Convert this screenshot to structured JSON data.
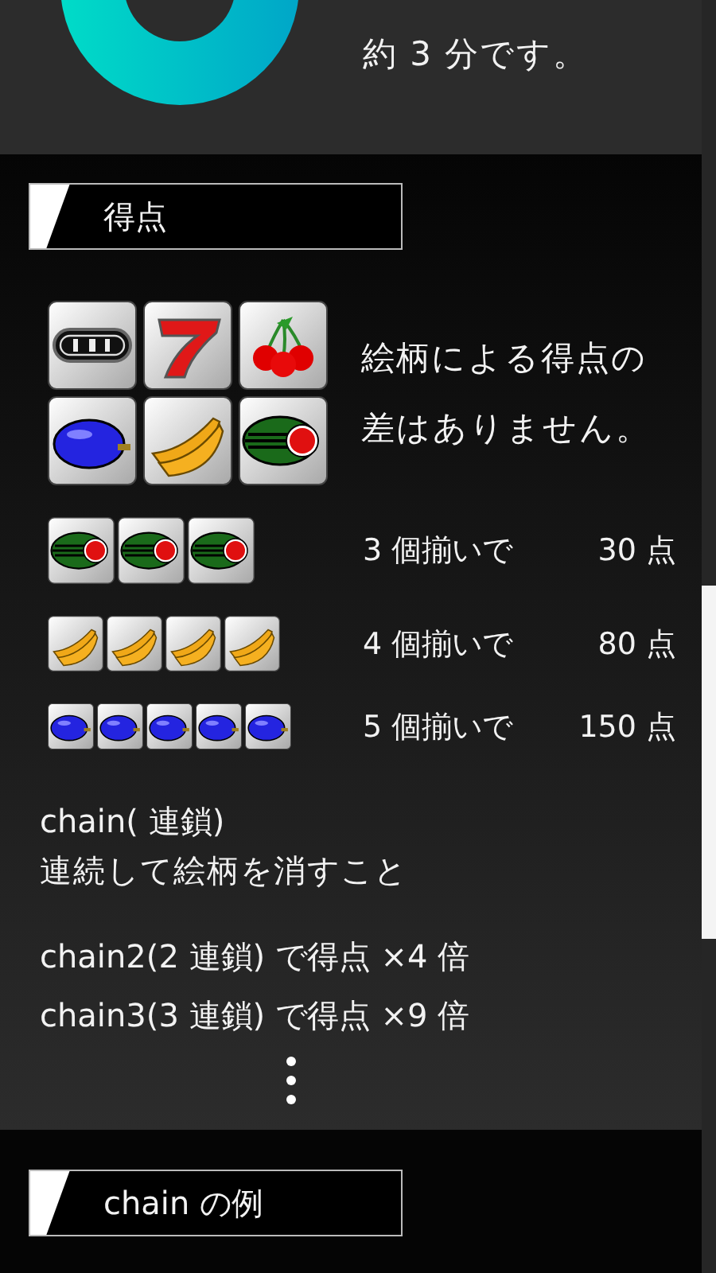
{
  "intro": {
    "text": "約 3 分です。"
  },
  "score_section": {
    "heading": "得点",
    "symbols": [
      {
        "kind": "bar"
      },
      {
        "kind": "seven"
      },
      {
        "kind": "cherry"
      },
      {
        "kind": "plum"
      },
      {
        "kind": "banana"
      },
      {
        "kind": "watermelon"
      }
    ],
    "note": "絵柄による得点の差はありません。",
    "combos": [
      {
        "tiles": [
          {
            "kind": "watermelon"
          },
          {
            "kind": "watermelon"
          },
          {
            "kind": "watermelon"
          }
        ],
        "label": "3 個揃いで",
        "points": "30 点"
      },
      {
        "tiles": [
          {
            "kind": "banana"
          },
          {
            "kind": "banana"
          },
          {
            "kind": "banana"
          },
          {
            "kind": "banana"
          }
        ],
        "label": "4 個揃いで",
        "points": "80 点"
      },
      {
        "tiles": [
          {
            "kind": "plum"
          },
          {
            "kind": "plum"
          },
          {
            "kind": "plum"
          },
          {
            "kind": "plum"
          },
          {
            "kind": "plum"
          }
        ],
        "label": "5 個揃いで",
        "points": "150 点"
      }
    ]
  },
  "chain_section": {
    "term": "chain( 連鎖)",
    "definition": "連続して絵柄を消すこと",
    "examples": [
      "chain2(2 連鎖) で得点 ×4 倍",
      "chain3(3 連鎖) で得点 ×9 倍"
    ]
  },
  "example_section": {
    "heading": "chain の例"
  }
}
